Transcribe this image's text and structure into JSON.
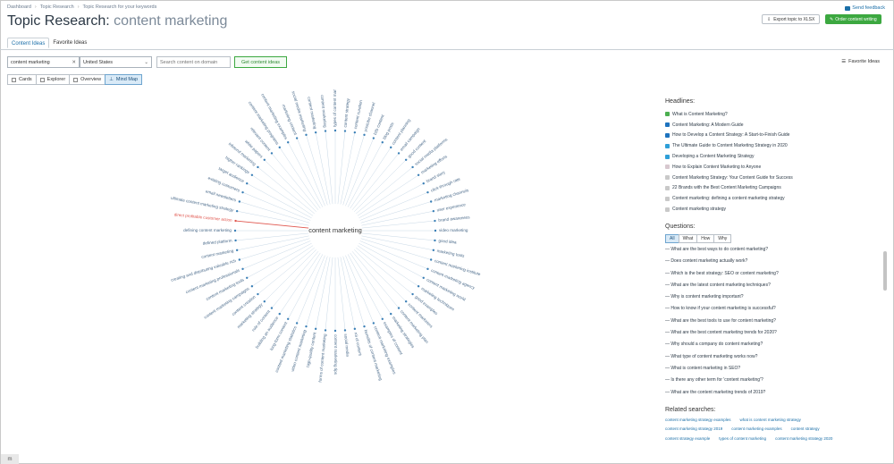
{
  "breadcrumb": [
    "Dashboard",
    "Topic Research",
    "Topic Research for your keywords"
  ],
  "title": {
    "prefix": "Topic Research: ",
    "keyword": "content marketing"
  },
  "send_feedback": "Send feedback",
  "export_label": "Export topic to XLSX",
  "order_label": "Order content writing",
  "tabs": [
    "Content Ideas",
    "Favorite Ideas"
  ],
  "search": {
    "value": "content marketing",
    "country": "United States",
    "domain_placeholder": "Search content on domain",
    "get_label": "Get content ideas"
  },
  "favorite_ideas_label": "Favorite Ideas",
  "views": [
    "Cards",
    "Explorer",
    "Overview",
    "Mind Map"
  ],
  "mindmap": {
    "center": "content marketing",
    "highlight_color": "#e0574f",
    "nodes": [
      "types of content marketing",
      "content strategy",
      "content curation",
      "youtube channel",
      "b2b content",
      "blog posts",
      "content planning",
      "email campaign",
      "good content",
      "social media platforms",
      "marketing efforts",
      "brand story",
      "click-through rate",
      "marketing channels",
      "user experience",
      "brand awareness",
      "video marketing",
      "good idea",
      "marketing tools",
      "content marketing institute",
      "content marketing agency",
      "content marketing world",
      "marketing techniques",
      "good examples",
      "content marketers",
      "content marketing plan",
      "marketing strategies",
      "examples of content",
      "content marketing examples",
      "benefits of content marketing",
      "roi of content",
      "social media",
      "content marketing tips",
      "forms of content marketing",
      "high-quality content",
      "video content marketing",
      "content marketing statistics",
      "long-form content",
      "building an audience",
      "role of content",
      "marketing strategy",
      "content creation",
      "content marketing campaigns",
      "content marketing tools",
      "content marketing professionals",
      "creating and distributing valuable rich",
      "content marketing",
      "defined platform",
      "defining content marketing",
      "direct profitable customer action",
      "ultimate content marketing strategy",
      "email newsletters",
      "existing customers",
      "target audience",
      "higher rankings",
      "inbound marketing",
      "white papers",
      "relevant content",
      "content marketing programs",
      "content marketing examples",
      "marketing content",
      "social media marketing",
      "content marketing",
      "content marketing"
    ]
  },
  "headlines": {
    "heading": "Headlines:",
    "items": [
      {
        "text": "What is Content Marketing?",
        "icon": "#4caf50"
      },
      {
        "text": "Content Marketing: A Modern Guide",
        "icon": "#1e73be"
      },
      {
        "text": "How to Develop a Content Strategy: A Start-to-Finish Guide",
        "icon": "#1e73be"
      },
      {
        "text": "The Ultimate Guide to Content Marketing Strategy in 2020",
        "icon": "#2e9fd8"
      },
      {
        "text": "Developing a Content Marketing Strategy",
        "icon": "#2e9fd8"
      },
      {
        "text": "How to Explain Content Marketing to Anyone",
        "icon": "#d7c8cf"
      },
      {
        "text": "Content Marketing Strategy: Your Content Guide for Success",
        "icon": "#c9c9c9"
      },
      {
        "text": "22 Brands with the Best Content Marketing Campaigns",
        "icon": "#c9c9c9"
      },
      {
        "text": "Content marketing: defining a content marketing strategy",
        "icon": "#c9c9c9"
      },
      {
        "text": "Content marketing strategy",
        "icon": "#c9c9c9"
      }
    ]
  },
  "questions": {
    "heading": "Questions:",
    "tabs": [
      "All",
      "What",
      "How",
      "Why"
    ],
    "items": [
      "What are the best ways to do content marketing?",
      "Does content marketing actually work?",
      "Which is the best strategy: SEO or content marketing?",
      "What are the latest content marketing techniques?",
      "Why is content marketing important?",
      "How to know if your content marketing is successful?",
      "What are the best tools to use for content marketing?",
      "What are the best content marketing trends for 2020?",
      "Why should a company do content marketing?",
      "What type of content marketing works now?",
      "What is content marketing in SEO?",
      "Is there any other term for 'content marketing'?",
      "What are the content marketing trends of 2019?"
    ]
  },
  "related": {
    "heading": "Related searches:",
    "items": [
      "content marketing strategy examples",
      "what is content marketing strategy",
      "content marketing strategy 2019",
      "content marketing examples",
      "content strategy",
      "content strategy example",
      "types of content marketing",
      "content marketing strategy 2020"
    ]
  },
  "bottom_tab": "m"
}
